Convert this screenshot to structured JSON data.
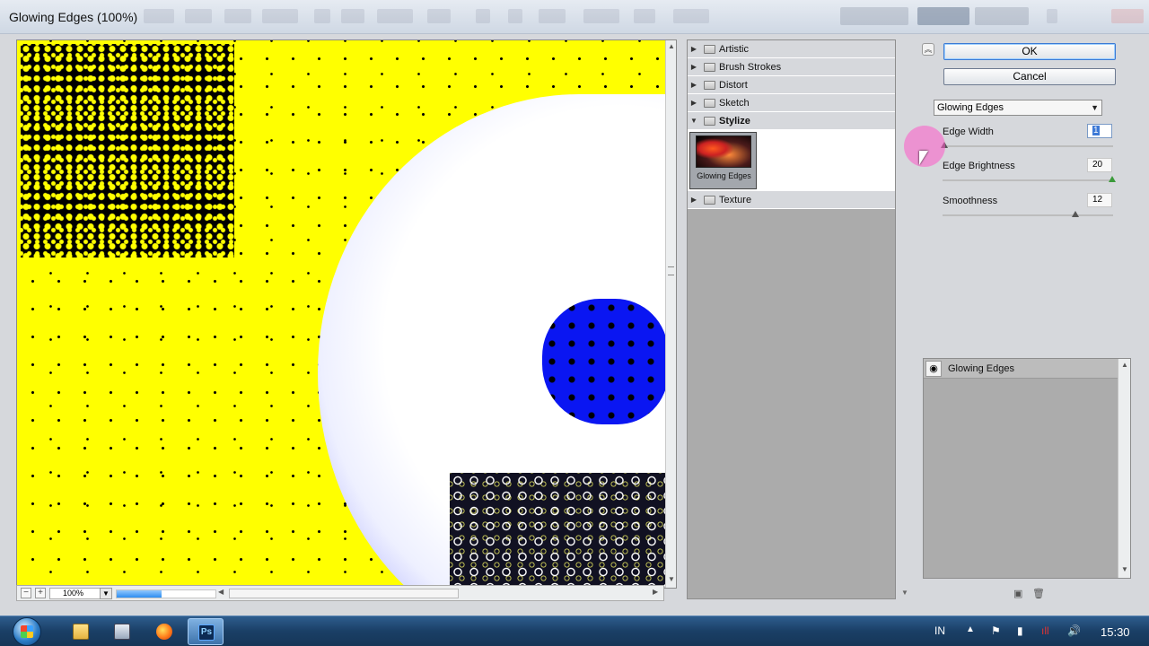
{
  "window": {
    "title": "Glowing Edges (100%)"
  },
  "preview": {
    "zoom": "100%",
    "zoom_minus": "−",
    "zoom_plus": "+",
    "render_progress_percent": 45
  },
  "filter_gallery": {
    "categories": [
      {
        "label": "Artistic",
        "expanded": false
      },
      {
        "label": "Brush Strokes",
        "expanded": false
      },
      {
        "label": "Distort",
        "expanded": false
      },
      {
        "label": "Sketch",
        "expanded": false
      },
      {
        "label": "Stylize",
        "expanded": true
      },
      {
        "label": "Texture",
        "expanded": false
      }
    ],
    "stylize_thumb_label": "Glowing Edges"
  },
  "buttons": {
    "ok": "OK",
    "cancel": "Cancel"
  },
  "filter_select": {
    "value": "Glowing Edges"
  },
  "params": {
    "edge_width": {
      "label": "Edge Width",
      "value": "1"
    },
    "edge_brightness": {
      "label": "Edge Brightness",
      "value": "20"
    },
    "smoothness": {
      "label": "Smoothness",
      "value": "12"
    }
  },
  "layers": {
    "items": [
      {
        "label": "Glowing Edges"
      }
    ]
  },
  "taskbar": {
    "language": "IN",
    "clock": "15:30",
    "ps_label": "Ps"
  },
  "colors": {
    "canvas_yellow": "#ffff00",
    "blob_blue": "#0a16f2",
    "taskbar": "#1a3f66",
    "ok_border": "#3b7ad4"
  },
  "icons": [
    "windows-start-icon",
    "explorer-icon",
    "media-player-icon",
    "firefox-icon",
    "photoshop-icon",
    "eye-icon",
    "folder-icon",
    "new-layer-icon",
    "delete-layer-icon",
    "network-icon",
    "volume-icon",
    "flag-icon",
    "battery-icon"
  ]
}
